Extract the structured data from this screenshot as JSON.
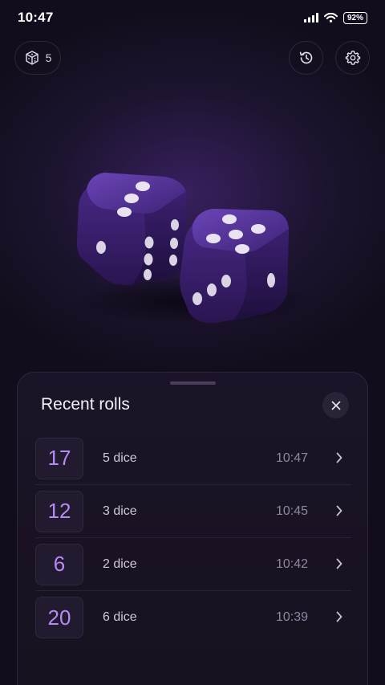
{
  "status_bar": {
    "time": "10:47",
    "battery": "92%"
  },
  "header": {
    "dice_count": "5"
  },
  "recent_rolls": {
    "title": "Recent rolls",
    "rows": [
      {
        "total": "17",
        "dice": "5 dice",
        "time": "10:47"
      },
      {
        "total": "12",
        "dice": "3 dice",
        "time": "10:45"
      },
      {
        "total": "6",
        "dice": "2 dice",
        "time": "10:42"
      },
      {
        "total": "20",
        "dice": "6 dice",
        "time": "10:39"
      }
    ]
  },
  "icons": {
    "signal": "signal-icon",
    "wifi": "wifi-icon",
    "battery": "battery-icon",
    "dice": "cube-dice-icon",
    "history": "history-icon",
    "settings": "gear-icon",
    "close": "close-icon",
    "chevron": "chevron-right-icon"
  },
  "colors": {
    "accent": "#b78af3",
    "dice_face": "#4a2a8a",
    "panel_bg": "#1b1428",
    "background": "#120d1c"
  }
}
